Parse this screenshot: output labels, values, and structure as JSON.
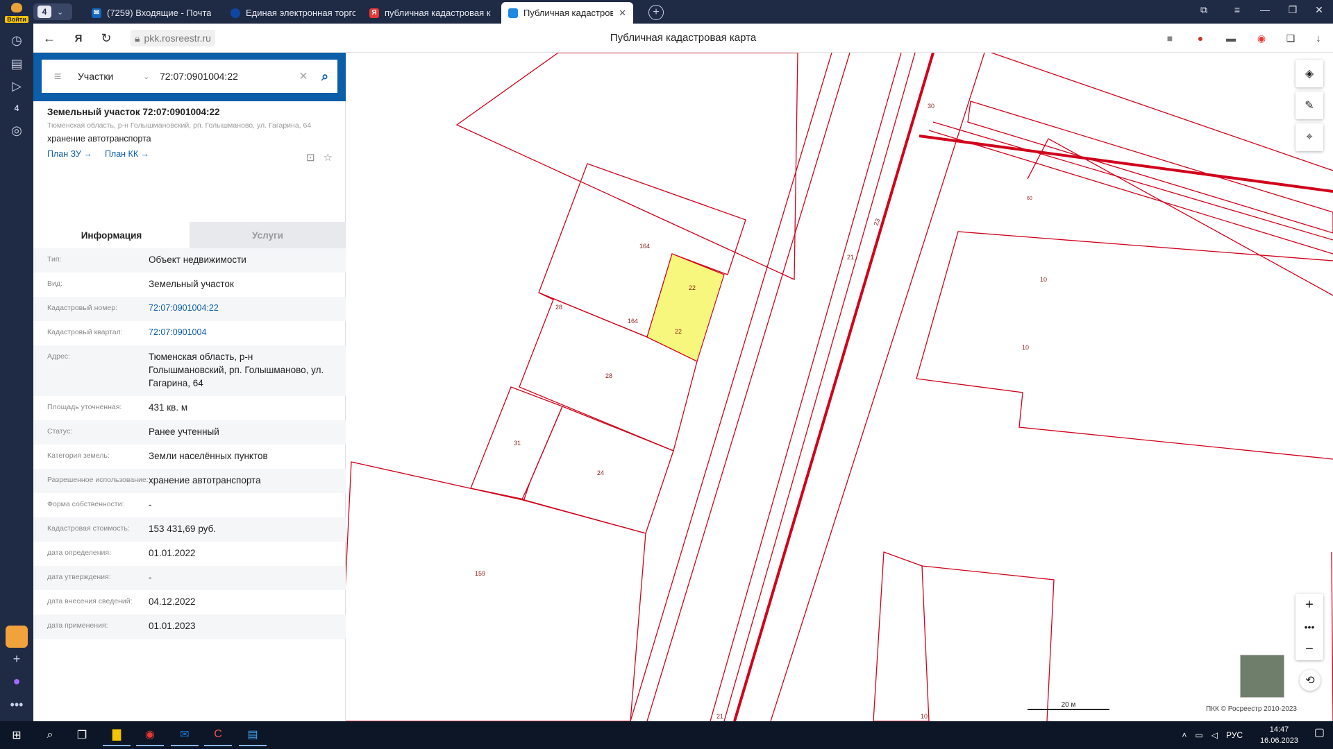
{
  "browser": {
    "login_label": "Войти",
    "tab_count": "4",
    "tabs": [
      {
        "label": "(7259) Входящие - Почта",
        "color": "#1565c0",
        "icon": "mail-icon"
      },
      {
        "label": "Единая электронная торго",
        "color": "#0d47a1",
        "icon": "globe-icon"
      },
      {
        "label": "публичная кадастровая к",
        "color": "#e53935",
        "icon": "yandex-icon"
      },
      {
        "label": "Публичная кадастрова",
        "color": "#1e88e5",
        "icon": "map-icon",
        "active": true
      }
    ],
    "url": "pkk.rosreestr.ru",
    "page_title": "Публичная кадастровая карта",
    "rail_badge": "4"
  },
  "search": {
    "type": "Участки",
    "value": "72:07:0901004:22"
  },
  "object": {
    "title": "Земельный участок 72:07:0901004:22",
    "address": "Тюменская область, р-н Голышмановский, рп. Голышманово, ул. Гагарина, 64",
    "use": "хранение автотранспорта",
    "link_plan_zu": "План ЗУ →",
    "link_plan_kk": "План КК →"
  },
  "info_tabs": {
    "info": "Информация",
    "services": "Услуги"
  },
  "attributes": [
    {
      "key": "Тип:",
      "value": "Объект недвижимости"
    },
    {
      "key": "Вид:",
      "value": "Земельный участок"
    },
    {
      "key": "Кадастровый номер:",
      "value": "72:07:0901004:22",
      "link": true
    },
    {
      "key": "Кадастровый квартал:",
      "value": "72:07:0901004",
      "link": true
    },
    {
      "key": "Адрес:",
      "value": "Тюменская область, р-н Голышмановский, рп. Голышманово, ул. Гагарина, 64"
    },
    {
      "key": "Площадь уточненная:",
      "value": "431 кв. м"
    },
    {
      "key": "Статус:",
      "value": "Ранее учтенный"
    },
    {
      "key": "Категория земель:",
      "value": "Земли населённых пунктов"
    },
    {
      "key": "Разрешенное использование:",
      "value": "хранение автотранспорта"
    },
    {
      "key": "Форма собственности:",
      "value": "-"
    },
    {
      "key": "Кадастровая стоимость:",
      "value": "153 431,69 руб."
    },
    {
      "key": "дата определения:",
      "value": "01.01.2022"
    },
    {
      "key": "дата утверждения:",
      "value": "-"
    },
    {
      "key": "дата внесения сведений:",
      "value": "04.12.2022"
    },
    {
      "key": "дата применения:",
      "value": "01.01.2023"
    }
  ],
  "map": {
    "labels": [
      "164",
      "22",
      "22",
      "164",
      "28",
      "28",
      "31",
      "24",
      "159",
      "159",
      "30",
      "23",
      "21",
      "21",
      "10",
      "10",
      "10",
      "60"
    ],
    "scale_label": "20 м",
    "copyright": "ПКК © Росреестр 2010-2023",
    "highlight_color": "#f7f77e",
    "line_color": "#d0021b"
  },
  "taskbar": {
    "lang": "РУС",
    "time": "14:47",
    "date": "16.06.2023"
  }
}
